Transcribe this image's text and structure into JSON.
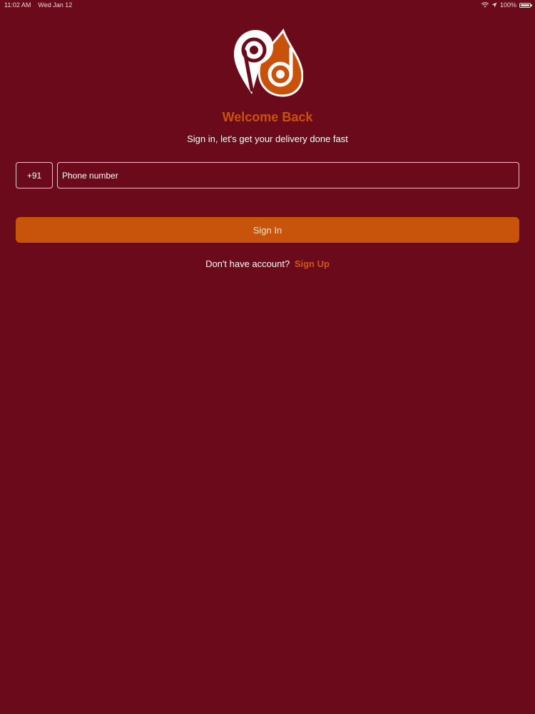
{
  "status_bar": {
    "time": "11:02 AM",
    "date": "Wed Jan 12",
    "battery": "100%",
    "battery_level": 1.0
  },
  "colors": {
    "background": "#6b0a1a",
    "accent": "#c7540a"
  },
  "header": {
    "logo_icon": "location-pin-pd-logo",
    "title": "Welcome Back",
    "subtitle": "Sign in, let's get your delivery done fast"
  },
  "form": {
    "country_code": "+91",
    "phone_placeholder": "Phone number",
    "phone_value": "",
    "signin_label": "Sign In"
  },
  "footer": {
    "prompt": "Don't have account?",
    "signup_label": "Sign Up"
  }
}
